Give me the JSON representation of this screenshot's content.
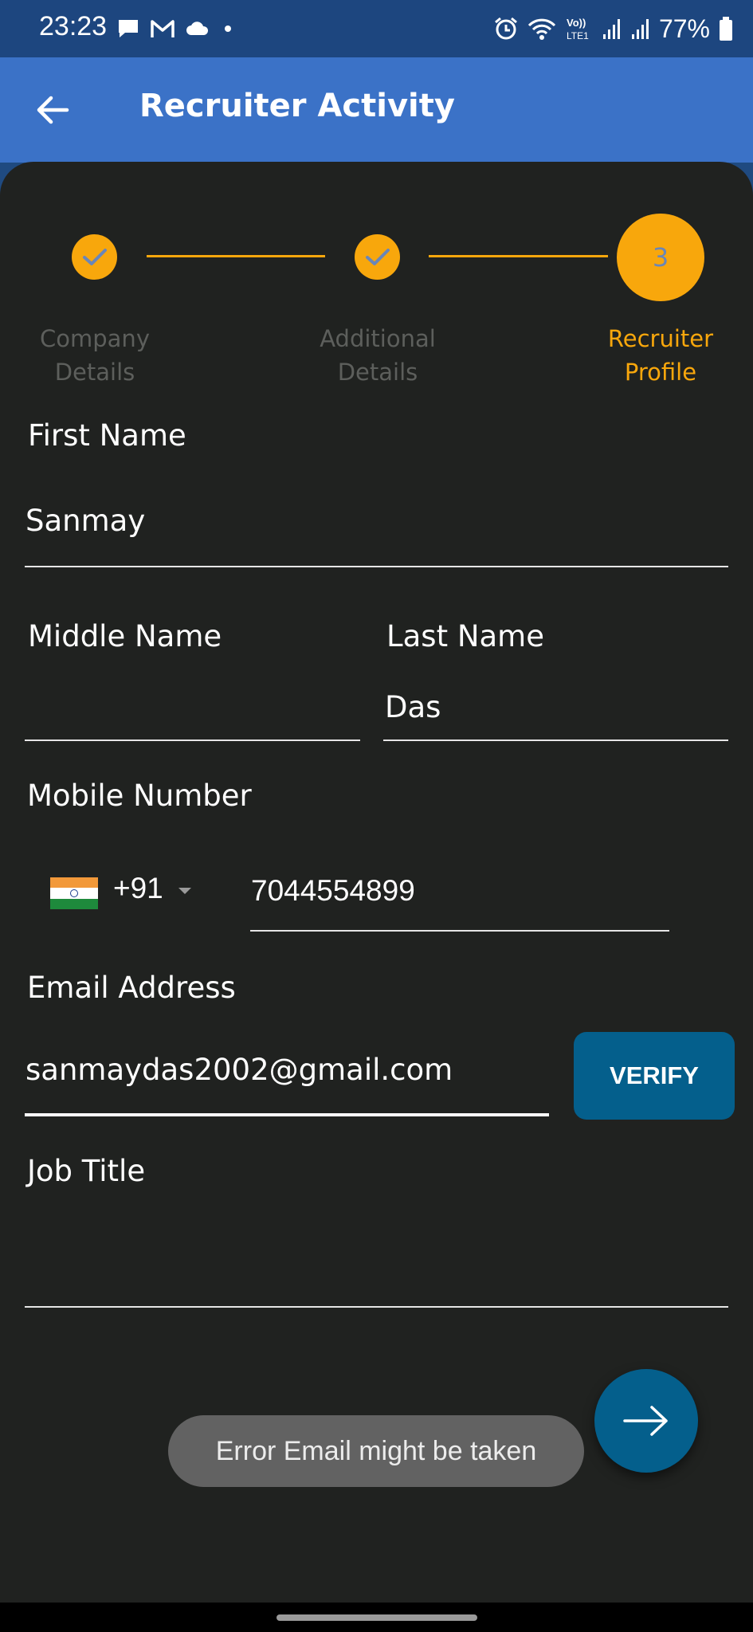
{
  "status_bar": {
    "time": "23:23",
    "battery": "77%",
    "left_icons": [
      "message-icon",
      "gmail-icon",
      "cloud-icon",
      "dot-icon"
    ],
    "right_icons": [
      "alarm-icon",
      "wifi-icon",
      "volte-icon",
      "signal-icon",
      "signal-icon",
      "battery-icon"
    ]
  },
  "appbar": {
    "title": "Recruiter Activity",
    "back_icon": "arrow-back-icon"
  },
  "stepper": {
    "steps": [
      {
        "label_line1": "Company",
        "label_line2": "Details",
        "state": "done"
      },
      {
        "label_line1": "Additional",
        "label_line2": "Details",
        "state": "done"
      },
      {
        "label_line1": "Recruiter",
        "label_line2": "Profile",
        "state": "active",
        "number": "3"
      }
    ],
    "accent_color": "#f8a70c",
    "inactive_label_color": "#5d5f5c"
  },
  "form": {
    "first_name": {
      "label": "First Name",
      "value": "Sanmay"
    },
    "middle_name": {
      "label": "Middle Name",
      "value": ""
    },
    "last_name": {
      "label": "Last Name",
      "value": "Das"
    },
    "mobile": {
      "label": "Mobile Number",
      "country_code": "+91",
      "flag": "india-flag-icon",
      "value": "7044554899"
    },
    "email": {
      "label": "Email Address",
      "value": "sanmaydas2002@gmail.com",
      "verify_label": "VERIFY"
    },
    "job_title": {
      "label": "Job Title",
      "value": ""
    }
  },
  "fab": {
    "icon": "arrow-forward-icon"
  },
  "toast": {
    "text": "Error Email might be taken"
  },
  "colors": {
    "appbar": "#3b72c7",
    "status_bar": "#1d467f",
    "background": "#202220",
    "button": "#045f8c"
  }
}
